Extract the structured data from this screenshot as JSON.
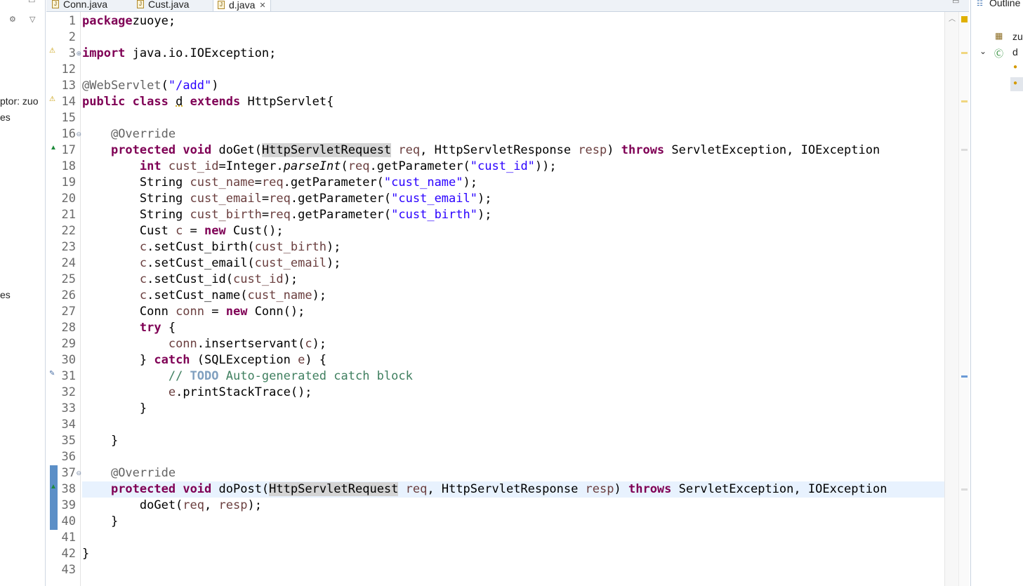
{
  "tabs": [
    {
      "label": "Conn.java",
      "active": false
    },
    {
      "label": "Cust.java",
      "active": false
    },
    {
      "label": "d.java",
      "active": true,
      "close": "✕"
    }
  ],
  "left_panel": {
    "fragments": [
      "ptor: zuo",
      "es",
      "es"
    ]
  },
  "outline": {
    "title": "Outline",
    "package_node": "zu",
    "class_node": "d"
  },
  "colors": {
    "keyword": "#7f0055",
    "string": "#2a00ff",
    "comment": "#3f7f5f",
    "annotation": "#646464",
    "variable": "#6a3e3e",
    "current_line": "#e8f2fe"
  },
  "editor": {
    "lines": [
      {
        "n": "1",
        "segs": [
          [
            "kw",
            "package"
          ],
          [
            "",
            "zuoye;"
          ]
        ]
      },
      {
        "n": "2",
        "segs": []
      },
      {
        "n": "3",
        "segs": [
          [
            "kw",
            "import"
          ],
          [
            "",
            " java.io.IOException;"
          ]
        ]
      },
      {
        "n": "12",
        "segs": []
      },
      {
        "n": "13",
        "segs": [
          [
            "ann",
            "@WebServlet"
          ],
          [
            "",
            "("
          ],
          [
            "str",
            "\"/add\""
          ],
          [
            "",
            ")"
          ]
        ]
      },
      {
        "n": "14",
        "segs": [
          [
            "kw",
            "public"
          ],
          [
            "",
            " "
          ],
          [
            "kw",
            "class"
          ],
          [
            "",
            " "
          ],
          [
            "und",
            "d"
          ],
          [
            "",
            " "
          ],
          [
            "kw",
            "extends"
          ],
          [
            "",
            " HttpServlet{"
          ]
        ]
      },
      {
        "n": "15",
        "segs": []
      },
      {
        "n": "16",
        "segs": [
          [
            "",
            "    "
          ],
          [
            "ann",
            "@Override"
          ]
        ]
      },
      {
        "n": "17",
        "segs": [
          [
            "",
            "    "
          ],
          [
            "kw",
            "protected"
          ],
          [
            "",
            " "
          ],
          [
            "kw",
            "void"
          ],
          [
            "",
            " doGet("
          ],
          [
            "occ",
            "HttpServletRequest"
          ],
          [
            "",
            " "
          ],
          [
            "var",
            "req"
          ],
          [
            "",
            ", HttpServletResponse "
          ],
          [
            "var",
            "resp"
          ],
          [
            "",
            ") "
          ],
          [
            "kw",
            "throws"
          ],
          [
            "",
            " ServletException, IOException"
          ]
        ]
      },
      {
        "n": "18",
        "segs": [
          [
            "",
            "        "
          ],
          [
            "kw",
            "int"
          ],
          [
            "",
            " "
          ],
          [
            "var",
            "cust_id"
          ],
          [
            "",
            "=Integer."
          ],
          [
            "ital",
            "parseInt"
          ],
          [
            "",
            "("
          ],
          [
            "var",
            "req"
          ],
          [
            "",
            ".getParameter("
          ],
          [
            "str",
            "\"cust_id\""
          ],
          [
            "",
            "));"
          ]
        ]
      },
      {
        "n": "19",
        "segs": [
          [
            "",
            "        String "
          ],
          [
            "var",
            "cust_name"
          ],
          [
            "",
            "="
          ],
          [
            "var",
            "req"
          ],
          [
            "",
            ".getParameter("
          ],
          [
            "str",
            "\"cust_name\""
          ],
          [
            "",
            ");"
          ]
        ]
      },
      {
        "n": "20",
        "segs": [
          [
            "",
            "        String "
          ],
          [
            "var",
            "cust_email"
          ],
          [
            "",
            "="
          ],
          [
            "var",
            "req"
          ],
          [
            "",
            ".getParameter("
          ],
          [
            "str",
            "\"cust_email\""
          ],
          [
            "",
            ");"
          ]
        ]
      },
      {
        "n": "21",
        "segs": [
          [
            "",
            "        String "
          ],
          [
            "var",
            "cust_birth"
          ],
          [
            "",
            "="
          ],
          [
            "var",
            "req"
          ],
          [
            "",
            ".getParameter("
          ],
          [
            "str",
            "\"cust_birth\""
          ],
          [
            "",
            ");"
          ]
        ]
      },
      {
        "n": "22",
        "segs": [
          [
            "",
            "        Cust "
          ],
          [
            "var",
            "c"
          ],
          [
            "",
            " = "
          ],
          [
            "kw",
            "new"
          ],
          [
            "",
            " Cust();"
          ]
        ]
      },
      {
        "n": "23",
        "segs": [
          [
            "",
            "        "
          ],
          [
            "var",
            "c"
          ],
          [
            "",
            ".setCust_birth("
          ],
          [
            "var",
            "cust_birth"
          ],
          [
            "",
            ");"
          ]
        ]
      },
      {
        "n": "24",
        "segs": [
          [
            "",
            "        "
          ],
          [
            "var",
            "c"
          ],
          [
            "",
            ".setCust_email("
          ],
          [
            "var",
            "cust_email"
          ],
          [
            "",
            ");"
          ]
        ]
      },
      {
        "n": "25",
        "segs": [
          [
            "",
            "        "
          ],
          [
            "var",
            "c"
          ],
          [
            "",
            ".setCust_id("
          ],
          [
            "var",
            "cust_id"
          ],
          [
            "",
            ");"
          ]
        ]
      },
      {
        "n": "26",
        "segs": [
          [
            "",
            "        "
          ],
          [
            "var",
            "c"
          ],
          [
            "",
            ".setCust_name("
          ],
          [
            "var",
            "cust_name"
          ],
          [
            "",
            ");"
          ]
        ]
      },
      {
        "n": "27",
        "segs": [
          [
            "",
            "        Conn "
          ],
          [
            "var",
            "conn"
          ],
          [
            "",
            " = "
          ],
          [
            "kw",
            "new"
          ],
          [
            "",
            " Conn();"
          ]
        ]
      },
      {
        "n": "28",
        "segs": [
          [
            "",
            "        "
          ],
          [
            "kw",
            "try"
          ],
          [
            "",
            " {"
          ]
        ]
      },
      {
        "n": "29",
        "segs": [
          [
            "",
            "            "
          ],
          [
            "var",
            "conn"
          ],
          [
            "",
            ".insertservant("
          ],
          [
            "var",
            "c"
          ],
          [
            "",
            ");"
          ]
        ]
      },
      {
        "n": "30",
        "segs": [
          [
            "",
            "        } "
          ],
          [
            "kw",
            "catch"
          ],
          [
            "",
            " (SQLException "
          ],
          [
            "var",
            "e"
          ],
          [
            "",
            ") {"
          ]
        ]
      },
      {
        "n": "31",
        "segs": [
          [
            "",
            "            "
          ],
          [
            "cmt",
            "// "
          ],
          [
            "todo",
            "TODO"
          ],
          [
            "cmt",
            " Auto-generated catch block"
          ]
        ]
      },
      {
        "n": "32",
        "segs": [
          [
            "",
            "            "
          ],
          [
            "var",
            "e"
          ],
          [
            "",
            ".printStackTrace();"
          ]
        ]
      },
      {
        "n": "33",
        "segs": [
          [
            "",
            "        }"
          ]
        ]
      },
      {
        "n": "34",
        "segs": []
      },
      {
        "n": "35",
        "segs": [
          [
            "",
            "    }"
          ]
        ]
      },
      {
        "n": "36",
        "segs": []
      },
      {
        "n": "37",
        "segs": [
          [
            "",
            "    "
          ],
          [
            "ann",
            "@Override"
          ]
        ]
      },
      {
        "n": "38",
        "segs": [
          [
            "",
            "    "
          ],
          [
            "kw",
            "protected"
          ],
          [
            "",
            " "
          ],
          [
            "kw",
            "void"
          ],
          [
            "",
            " doPost("
          ],
          [
            "occ",
            "HttpServletRequest"
          ],
          [
            "",
            " "
          ],
          [
            "var",
            "req"
          ],
          [
            "",
            ", HttpServletResponse "
          ],
          [
            "var",
            "resp"
          ],
          [
            "",
            ") "
          ],
          [
            "kw",
            "throws"
          ],
          [
            "",
            " ServletException, IOException"
          ]
        ]
      },
      {
        "n": "39",
        "segs": [
          [
            "",
            "        doGet("
          ],
          [
            "var",
            "req"
          ],
          [
            "",
            ", "
          ],
          [
            "var",
            "resp"
          ],
          [
            "",
            ");"
          ]
        ]
      },
      {
        "n": "40",
        "segs": [
          [
            "",
            "    }"
          ]
        ]
      },
      {
        "n": "41",
        "segs": []
      },
      {
        "n": "42",
        "segs": [
          [
            "",
            "}"
          ]
        ]
      },
      {
        "n": "43",
        "segs": []
      }
    ]
  }
}
